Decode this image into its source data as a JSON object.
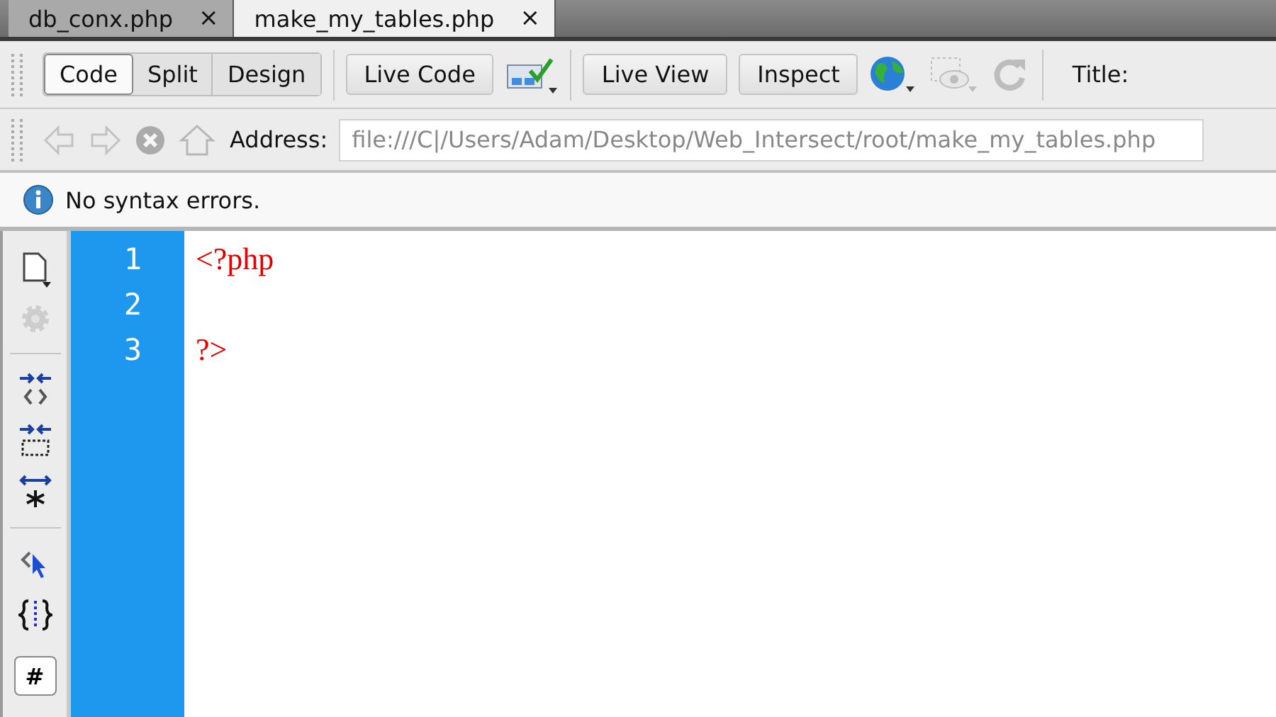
{
  "tabs": [
    {
      "label": "db_conx.php",
      "close": "×",
      "selected": false
    },
    {
      "label": "make_my_tables.php",
      "close": "×",
      "selected": true
    }
  ],
  "view_buttons": [
    {
      "label": "Code",
      "selected": true
    },
    {
      "label": "Split",
      "selected": false
    },
    {
      "label": "Design",
      "selected": false
    }
  ],
  "live_code": {
    "label": "Live Code"
  },
  "live_view": {
    "label": "Live View"
  },
  "inspect": {
    "label": "Inspect"
  },
  "toolbar_icons": [
    {
      "kind": "globe",
      "disabled": false
    },
    {
      "kind": "eye",
      "disabled": true
    },
    {
      "kind": "refresh",
      "disabled": true
    }
  ],
  "title_label": "Title:",
  "address_bar": {
    "nav": [
      {
        "kind": "back",
        "disabled": true
      },
      {
        "kind": "forward",
        "disabled": true
      },
      {
        "kind": "stop",
        "disabled": true
      },
      {
        "kind": "home",
        "disabled": true
      }
    ],
    "label": "Address:",
    "value": "file:///C|/Users/Adam/Desktop/Web_Intersect/root/make_my_tables.php"
  },
  "info_bar": {
    "message": "No syntax errors."
  },
  "side_tools": [
    {
      "kind": "document",
      "disabled": false
    },
    {
      "kind": "gear",
      "disabled": true
    },
    {
      "kind": "sep"
    },
    {
      "kind": "collapse-tag",
      "disabled": false
    },
    {
      "kind": "collapse-selection",
      "disabled": false
    },
    {
      "kind": "expand-all",
      "disabled": false
    },
    {
      "kind": "sep"
    },
    {
      "kind": "select-parent",
      "disabled": false
    },
    {
      "kind": "braces",
      "disabled": false
    }
  ],
  "side_button": "#",
  "code_lines": [
    {
      "number": "1",
      "text": "<?php"
    },
    {
      "number": "2"
    },
    {
      "number": "3",
      "text": "?>"
    }
  ]
}
